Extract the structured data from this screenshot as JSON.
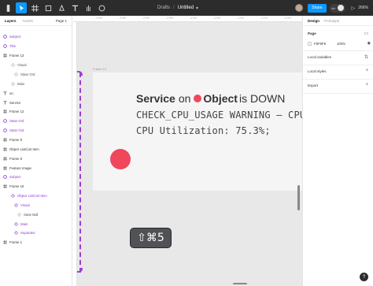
{
  "toolbar": {
    "breadcrumb_team": "Drafts",
    "breadcrumb_sep": "/",
    "file_name": "Untitled",
    "share_label": "Share",
    "devmode_label": "</>",
    "zoom_label": "266%"
  },
  "left_panel": {
    "tab_layers": "Layers",
    "tab_assets": "Assets",
    "page_label": "Page 1",
    "layers": [
      {
        "label": "Subject",
        "icon": "component-icon",
        "tone": "purple"
      },
      {
        "label": "Title",
        "icon": "component-icon",
        "tone": "purple"
      },
      {
        "label": "Frame 13",
        "icon": "frame-icon",
        "tone": "normal"
      },
      {
        "label": "Visual",
        "icon": "instance-icon",
        "tone": "gray"
      },
      {
        "label": "State Ord",
        "icon": "instance-icon",
        "tone": "gray"
      },
      {
        "label": "Main",
        "icon": "instance-icon",
        "tone": "gray"
      },
      {
        "label": "on",
        "icon": "text-icon",
        "tone": "normal"
      },
      {
        "label": "Service",
        "icon": "text-icon",
        "tone": "normal"
      },
      {
        "label": "Frame 12",
        "icon": "frame-icon",
        "tone": "normal"
      },
      {
        "label": "State Ord",
        "icon": "component-icon",
        "tone": "purple"
      },
      {
        "label": "State Ord",
        "icon": "component-icon",
        "tone": "purple"
      },
      {
        "label": "Frame 9",
        "icon": "frame-icon",
        "tone": "normal"
      },
      {
        "label": "Object List/List Item",
        "icon": "frame-icon",
        "tone": "normal"
      },
      {
        "label": "Frame 8",
        "icon": "frame-icon",
        "tone": "normal"
      },
      {
        "label": "Feature Image",
        "icon": "frame-icon",
        "tone": "normal"
      },
      {
        "label": "Subject",
        "icon": "component-icon",
        "tone": "purple"
      },
      {
        "label": "Frame 16",
        "icon": "frame-icon",
        "tone": "normal"
      },
      {
        "label": "Object List/List Item",
        "icon": "instance-icon",
        "tone": "purple"
      },
      {
        "label": "Visual",
        "icon": "instance-icon",
        "tone": "purple"
      },
      {
        "label": "State Ball",
        "icon": "instance-icon",
        "tone": "gray"
      },
      {
        "label": "Main",
        "icon": "instance-icon",
        "tone": "purple"
      },
      {
        "label": "Separator",
        "icon": "instance-icon",
        "tone": "purple"
      },
      {
        "label": "Frame 1",
        "icon": "frame-icon",
        "tone": "normal"
      }
    ]
  },
  "canvas": {
    "ruler_labels": [
      "-2790",
      "-2780",
      "-2760",
      "-2750",
      "-2740",
      "-2730",
      "-2720",
      "-2710",
      "-2700"
    ],
    "frame_label": "Frame 13",
    "line1": {
      "service": "Service",
      "on": "on",
      "object": "Object",
      "status": "is DOWN"
    },
    "line2": "CHECK_CPU_USAGE WARNING – CPU",
    "line3": "CPU Utilization: 75.3%;",
    "shortcut": "⇧⌘5",
    "accent_color": "#f0475a",
    "guide_color": "#9b3fd4"
  },
  "right_panel": {
    "tab_design": "Design",
    "tab_prototype": "Prototype",
    "page_section": "Page",
    "page_color": "F5F5F5",
    "page_opacity": "100%",
    "local_variables": "Local variables",
    "local_styles": "Local styles",
    "export": "Export",
    "help": "?"
  }
}
